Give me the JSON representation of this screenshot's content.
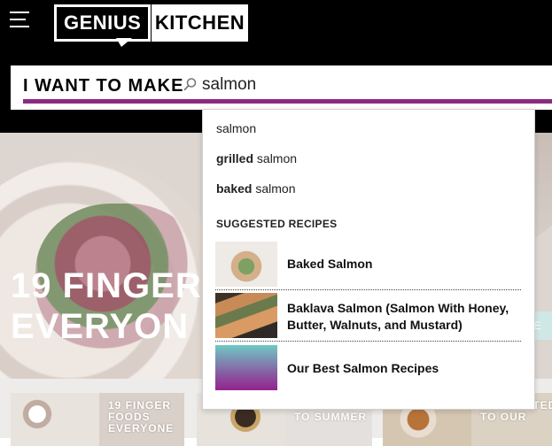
{
  "header": {
    "logo": {
      "word1": "GENIUS",
      "word2": "KITCHEN"
    }
  },
  "search": {
    "prompt": "I WANT TO MAKE",
    "value": "salmon"
  },
  "suggestions": [
    {
      "bold": "",
      "text": "salmon"
    },
    {
      "bold": "grilled",
      "text": " salmon"
    },
    {
      "bold": "baked",
      "text": " salmon"
    }
  ],
  "suggested_recipes": {
    "heading": "SUGGESTED RECIPES",
    "items": [
      {
        "title": "Baked Salmon"
      },
      {
        "title": "Baklava Salmon (Salmon With Honey, Butter, Walnuts, and Mustard)"
      },
      {
        "title": "Our Best Salmon Recipes"
      }
    ]
  },
  "hero": {
    "headline_line1": "19 FINGER",
    "headline_line2": "EVERYON",
    "badge_text": "E"
  },
  "cards": [
    {
      "label": "19 FINGER FOODS EVERYONE"
    },
    {
      "label": "WELCOME TO SUMMER"
    },
    {
      "label": "GET INVITED TO OUR"
    }
  ],
  "colors": {
    "accent": "#8c2a80",
    "header_bg": "#000000"
  }
}
